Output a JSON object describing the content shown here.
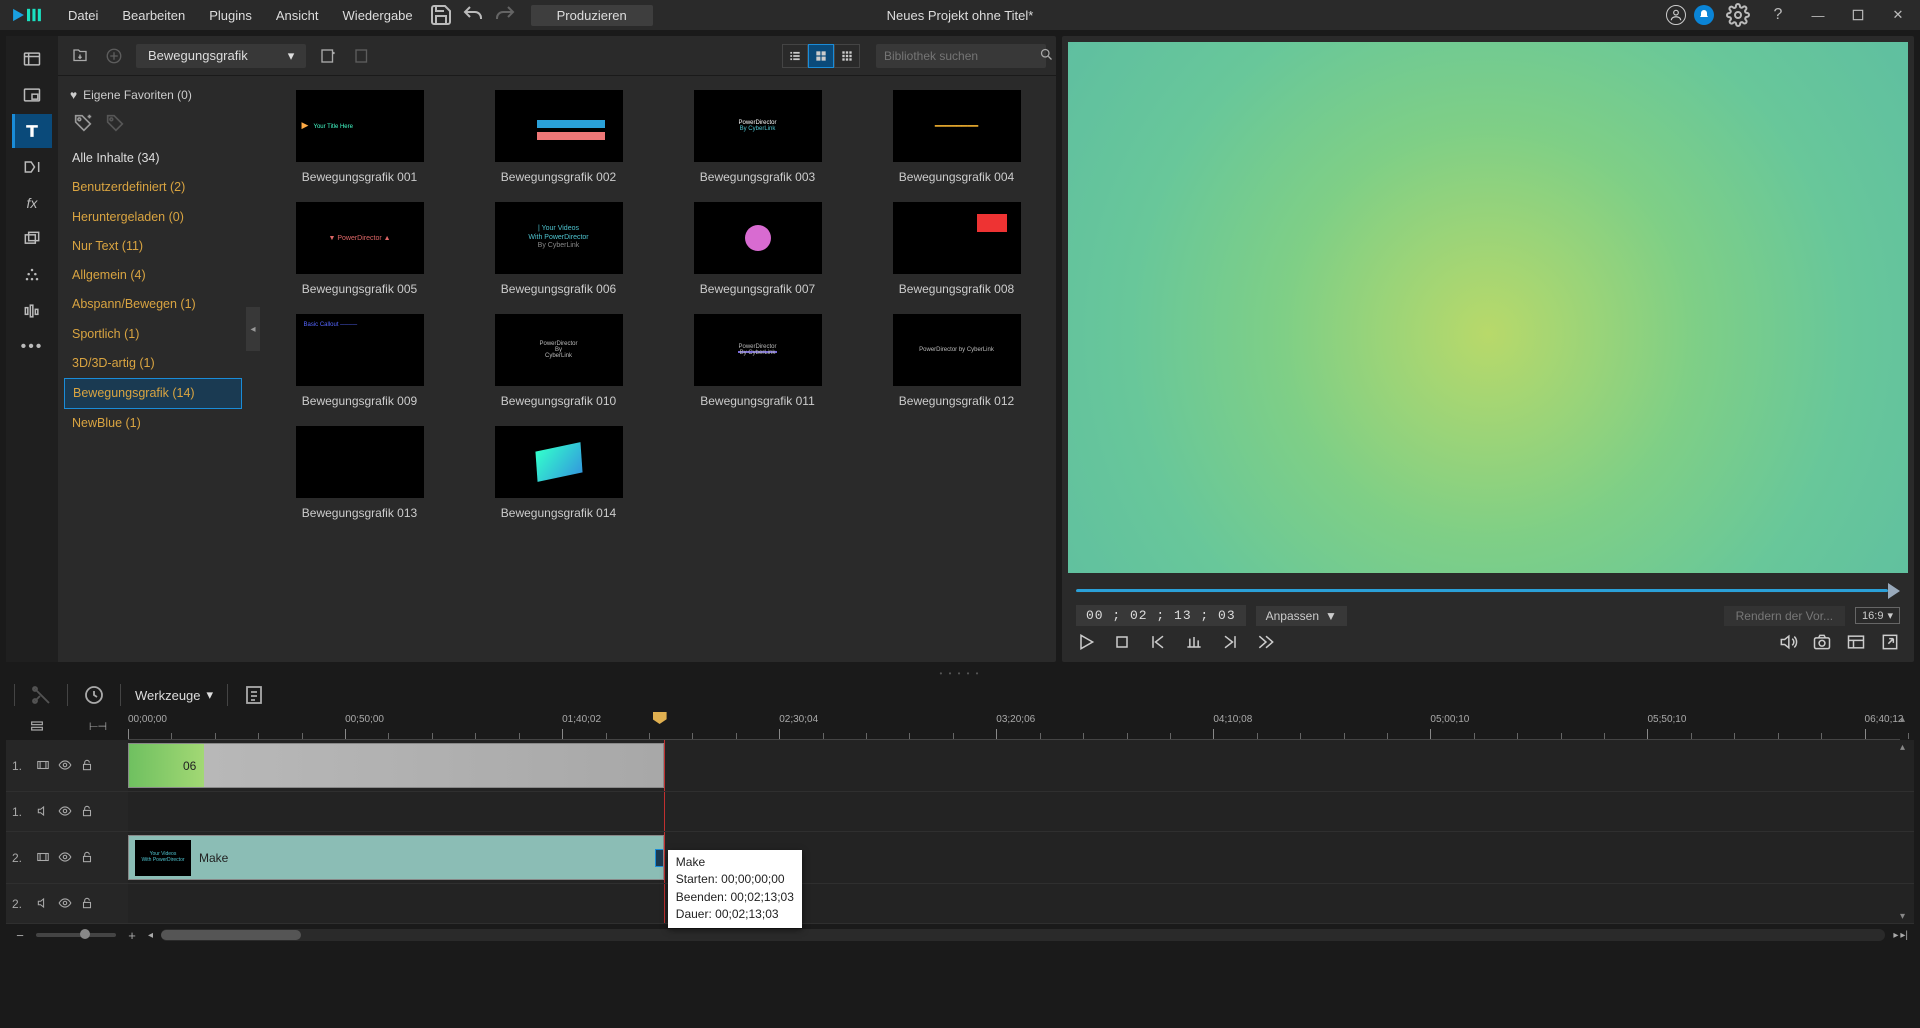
{
  "menu": {
    "file": "Datei",
    "edit": "Bearbeiten",
    "plugins": "Plugins",
    "view": "Ansicht",
    "playback": "Wiedergabe"
  },
  "produce": "Produzieren",
  "project_title": "Neues Projekt ohne Titel*",
  "library": {
    "dropdown": "Bewegungsgrafik",
    "search_placeholder": "Bibliothek suchen",
    "favorites": "Eigene Favoriten (0)",
    "categories": [
      {
        "label": "Alle Inhalte (34)",
        "white": true
      },
      {
        "label": "Benutzerdefiniert  (2)"
      },
      {
        "label": "Heruntergeladen  (0)"
      },
      {
        "label": "Nur Text  (11)"
      },
      {
        "label": "Allgemein  (4)"
      },
      {
        "label": "Abspann/Bewegen  (1)"
      },
      {
        "label": "Sportlich  (1)"
      },
      {
        "label": "3D/3D-artig  (1)"
      },
      {
        "label": "Bewegungsgrafik  (14)",
        "selected": true
      },
      {
        "label": "NewBlue  (1)"
      }
    ],
    "thumbs": [
      "Bewegungsgrafik 001",
      "Bewegungsgrafik 002",
      "Bewegungsgrafik 003",
      "Bewegungsgrafik 004",
      "Bewegungsgrafik 005",
      "Bewegungsgrafik 006",
      "Bewegungsgrafik 007",
      "Bewegungsgrafik 008",
      "Bewegungsgrafik 009",
      "Bewegungsgrafik 010",
      "Bewegungsgrafik 011",
      "Bewegungsgrafik 012",
      "Bewegungsgrafik 013",
      "Bewegungsgrafik 014"
    ],
    "thumb6_text": "| Your Videos\nWith PowerDirector\nBy CyberLink"
  },
  "preview": {
    "timecode": "00 ; 02 ; 13 ; 03",
    "fit": "Anpassen",
    "render": "Rendern der Vor...",
    "aspect": "16:9"
  },
  "timeline": {
    "tools_label": "Werkzeuge",
    "ruler": [
      "00;00;00",
      "00;50;00",
      "01;40;02",
      "02;30;04",
      "03;20;06",
      "04;10;08",
      "05;00;10",
      "05;50;10",
      "06;40;12"
    ],
    "tracks": [
      {
        "num": "1.",
        "kind": "video"
      },
      {
        "num": "1.",
        "kind": "audio"
      },
      {
        "num": "2.",
        "kind": "video"
      },
      {
        "num": "2.",
        "kind": "audio"
      }
    ],
    "clip1_label": "06",
    "clip2_label": "Make",
    "tooltip": {
      "title": "Make",
      "start": "Starten: 00;00;00;00",
      "end": "Beenden: 00;02;13;03",
      "dur": "Dauer: 00;02;13;03"
    }
  }
}
